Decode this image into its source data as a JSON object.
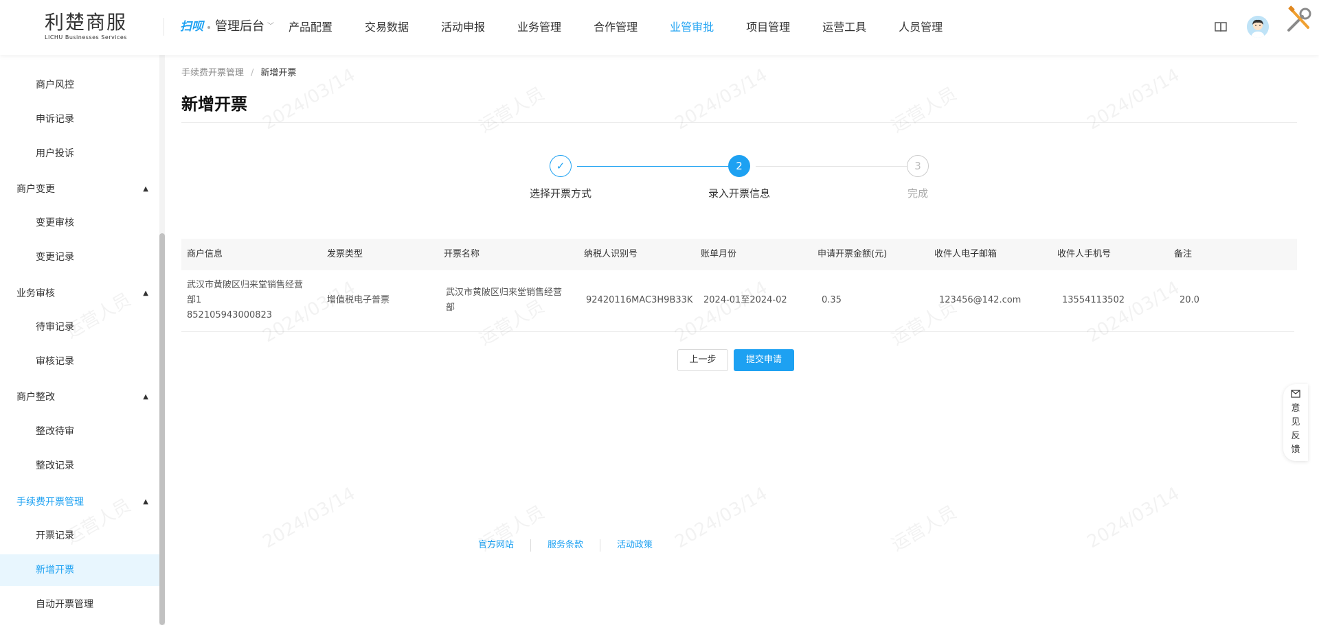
{
  "header": {
    "logo_cn": "利楚商服",
    "logo_en": "LICHU Businesses Services",
    "brand_mini": "扫呗",
    "switcher_label": "管理后台",
    "nav": [
      "产品配置",
      "交易数据",
      "活动申报",
      "业务管理",
      "合作管理",
      "业管审批",
      "项目管理",
      "运营工具",
      "人员管理"
    ],
    "nav_active": "业管审批"
  },
  "sidebar": {
    "items": [
      {
        "label": "商户风控",
        "type": "sub"
      },
      {
        "label": "申诉记录",
        "type": "sub"
      },
      {
        "label": "用户投诉",
        "type": "sub"
      },
      {
        "label": "商户变更",
        "type": "group"
      },
      {
        "label": "变更审核",
        "type": "sub"
      },
      {
        "label": "变更记录",
        "type": "sub"
      },
      {
        "label": "业务审核",
        "type": "group"
      },
      {
        "label": "待审记录",
        "type": "sub"
      },
      {
        "label": "审核记录",
        "type": "sub"
      },
      {
        "label": "商户整改",
        "type": "group"
      },
      {
        "label": "整改待审",
        "type": "sub"
      },
      {
        "label": "整改记录",
        "type": "sub"
      },
      {
        "label": "手续费开票管理",
        "type": "group",
        "active": true
      },
      {
        "label": "开票记录",
        "type": "sub"
      },
      {
        "label": "新增开票",
        "type": "sub",
        "selected": true
      },
      {
        "label": "自动开票管理",
        "type": "sub"
      }
    ]
  },
  "breadcrumb": {
    "parent": "手续费开票管理",
    "sep": "/",
    "current": "新增开票"
  },
  "page_title": "新增开票",
  "steps": [
    {
      "label": "选择开票方式",
      "marker": "✓",
      "state": "done"
    },
    {
      "label": "录入开票信息",
      "marker": "2",
      "state": "active"
    },
    {
      "label": "完成",
      "marker": "3",
      "state": "pending"
    }
  ],
  "table": {
    "columns": [
      "商户信息",
      "发票类型",
      "开票名称",
      "纳税人识别号",
      "账单月份",
      "申请开票金额(元)",
      "收件人电子邮箱",
      "收件人手机号",
      "备注"
    ],
    "row": {
      "merchant_line1": "武汉市黄陂区归来堂销售经营",
      "merchant_line2": "部1",
      "merchant_line3": "852105943000823",
      "invoice_type": "增值税电子普票",
      "invoice_name_line1": "武汉市黄陂区归来堂销售经营",
      "invoice_name_line2": "部",
      "tax_id": "92420116MAC3H9B33K",
      "bill_month": "2024-01至2024-02",
      "amount": "0.35",
      "email": "123456@142.com",
      "phone": "13554113502",
      "remark": "20.0"
    }
  },
  "buttons": {
    "prev": "上一步",
    "submit": "提交申请"
  },
  "footer": [
    "官方网站",
    "服务条款",
    "活动政策"
  ],
  "feedback": {
    "label": "意见反馈"
  },
  "watermark": {
    "name": "运营人员",
    "date": "2024/03/14"
  },
  "colors": {
    "accent": "#1da1f2"
  }
}
